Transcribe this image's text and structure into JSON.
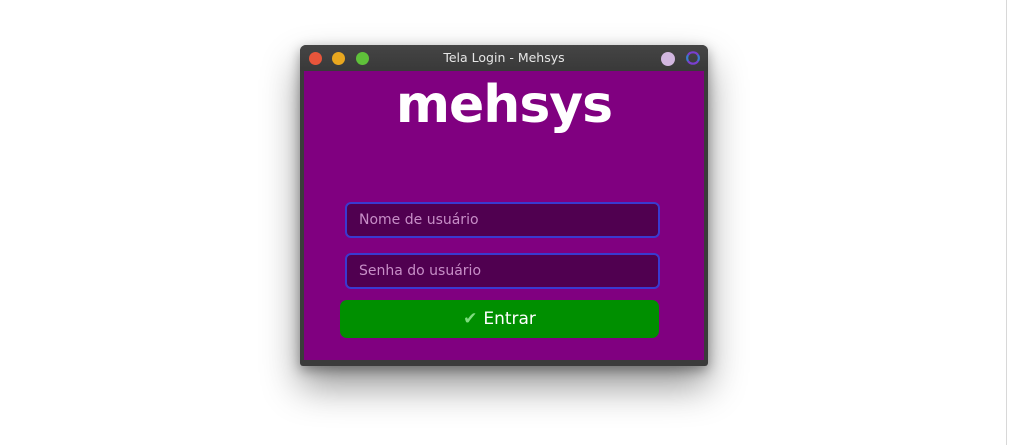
{
  "window": {
    "title": "Tela Login - Mehsys"
  },
  "logo": {
    "text": "mehsys"
  },
  "form": {
    "username_placeholder": "Nome de usuário",
    "username_value": "",
    "password_placeholder": "Senha do usuário",
    "password_value": "",
    "submit_label": "Entrar",
    "submit_icon": "check-icon"
  },
  "colors": {
    "background": "#800080",
    "input_background": "#500050",
    "input_border": "#3a3ad0",
    "button": "#008f00",
    "titlebar": "#3b3b3b"
  }
}
